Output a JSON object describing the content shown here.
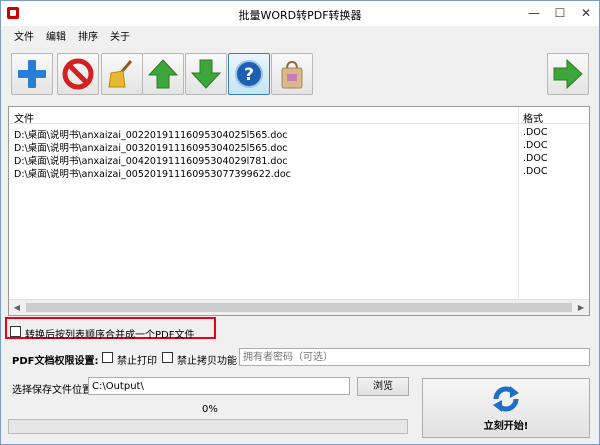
{
  "window": {
    "title": "批量WORD转PDF转换器",
    "min": "—",
    "max": "☐",
    "close": "✕"
  },
  "menu": [
    "文件",
    "编辑",
    "排序",
    "关于"
  ],
  "toolbar": {
    "icons": [
      "add-icon",
      "remove-icon",
      "clear-broom-icon",
      "move-up-icon",
      "move-down-icon",
      "help-icon",
      "bag-icon",
      "next-arrow-icon"
    ],
    "colors": {
      "blue": "#2a7ed6",
      "red": "#d42020",
      "green": "#3da63a",
      "accent_blue": "#3c7fb1"
    }
  },
  "file_list": {
    "columns": [
      "文件",
      "格式"
    ],
    "rows": [
      {
        "path": "D:\\桌面\\说明书\\anxaizai_00220191116095304025l565.doc",
        "format": ".DOC"
      },
      {
        "path": "D:\\桌面\\说明书\\anxaizai_00320191116095304025l565.doc",
        "format": ".DOC"
      },
      {
        "path": "D:\\桌面\\说明书\\anxaizai_00420191116095304029l781.doc",
        "format": ".DOC"
      },
      {
        "path": "D:\\桌面\\说明书\\anxaizai_00520191116095307739962​2.doc",
        "format": ".DOC"
      }
    ]
  },
  "merge_option": {
    "label": "转换后按列表顺序合并成一个PDF文件",
    "checked": false
  },
  "permissions": {
    "label": "PDF文档权限设置:",
    "no_print": "禁止打印",
    "no_copy": "禁止拷贝功能",
    "owner_password_placeholder": "拥有者密码（可选）"
  },
  "output": {
    "label": "选择保存文件位置",
    "path": "C:\\Output\\",
    "browse": "浏览"
  },
  "progress": {
    "text": "0%",
    "value": 0
  },
  "start_button": {
    "label": "立刻开始!"
  }
}
